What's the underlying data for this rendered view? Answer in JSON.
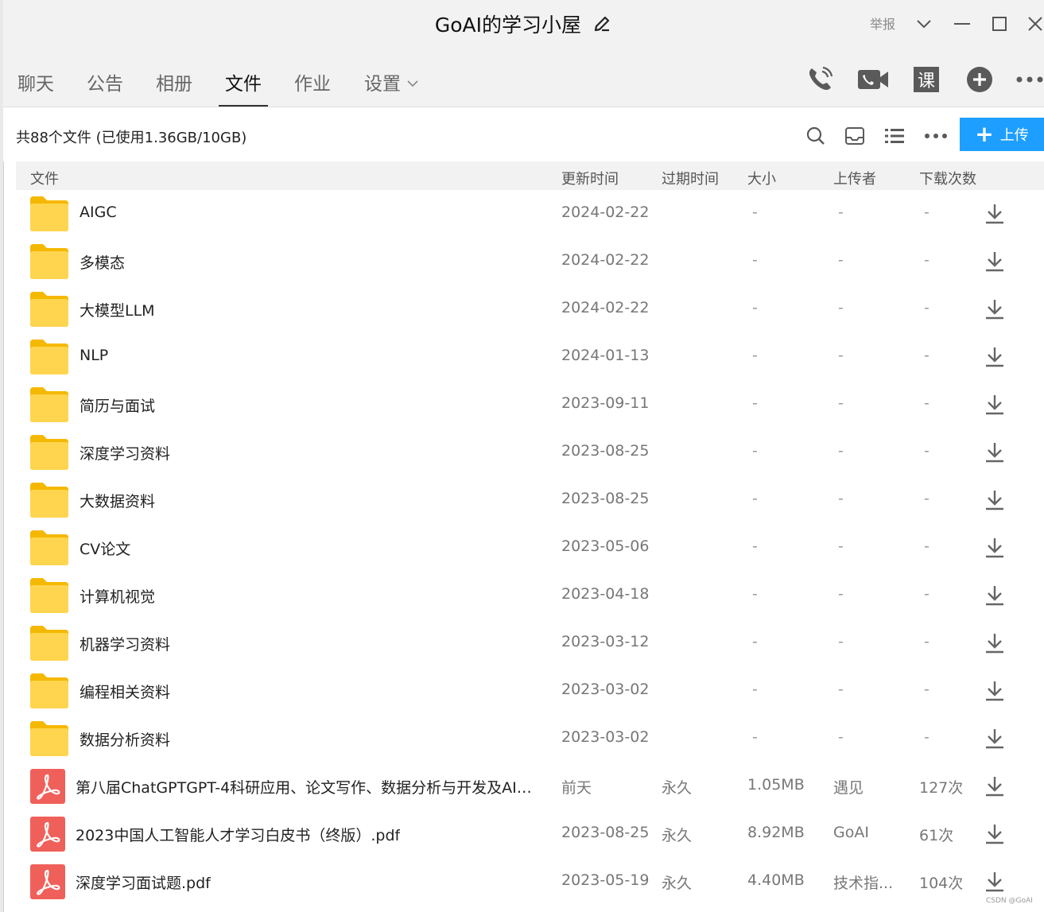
{
  "window": {
    "title": "GoAI的学习小屋",
    "report_label": "举报",
    "icons": [
      "edit-icon",
      "chevron-down-icon",
      "minimize-icon",
      "maximize-icon",
      "close-icon"
    ]
  },
  "tabs": [
    {
      "label": "聊天"
    },
    {
      "label": "公告"
    },
    {
      "label": "相册"
    },
    {
      "label": "文件",
      "active": true
    },
    {
      "label": "作业"
    },
    {
      "label": "设置"
    }
  ],
  "toolbar_icons": [
    "phone-icon",
    "video-icon",
    "course-icon",
    "add-circle-icon",
    "more-icon"
  ],
  "course_glyph": "课",
  "file_toolbar": {
    "summary": "共88个文件 (已使用1.36GB/10GB)",
    "upload_label": "上传",
    "icons": [
      "search-icon",
      "inbox-icon",
      "list-view-icon",
      "more-icon"
    ]
  },
  "columns": {
    "name": "文件",
    "updated": "更新时间",
    "expires": "过期时间",
    "size": "大小",
    "uploader": "上传者",
    "downloads": "下载次数"
  },
  "files": [
    {
      "type": "folder",
      "name": "AIGC",
      "updated": "2024-02-22",
      "expires": "",
      "size": "-",
      "uploader": "-",
      "downloads": "-"
    },
    {
      "type": "folder",
      "name": "多模态",
      "updated": "2024-02-22",
      "expires": "",
      "size": "-",
      "uploader": "-",
      "downloads": "-"
    },
    {
      "type": "folder",
      "name": "大模型LLM",
      "updated": "2024-02-22",
      "expires": "",
      "size": "-",
      "uploader": "-",
      "downloads": "-"
    },
    {
      "type": "folder",
      "name": "NLP",
      "updated": "2024-01-13",
      "expires": "",
      "size": "-",
      "uploader": "-",
      "downloads": "-"
    },
    {
      "type": "folder",
      "name": "简历与面试",
      "updated": "2023-09-11",
      "expires": "",
      "size": "-",
      "uploader": "-",
      "downloads": "-"
    },
    {
      "type": "folder",
      "name": "深度学习资料",
      "updated": "2023-08-25",
      "expires": "",
      "size": "-",
      "uploader": "-",
      "downloads": "-"
    },
    {
      "type": "folder",
      "name": "大数据资料",
      "updated": "2023-08-25",
      "expires": "",
      "size": "-",
      "uploader": "-",
      "downloads": "-"
    },
    {
      "type": "folder",
      "name": "CV论文",
      "updated": "2023-05-06",
      "expires": "",
      "size": "-",
      "uploader": "-",
      "downloads": "-"
    },
    {
      "type": "folder",
      "name": "计算机视觉",
      "updated": "2023-04-18",
      "expires": "",
      "size": "-",
      "uploader": "-",
      "downloads": "-"
    },
    {
      "type": "folder",
      "name": "机器学习资料",
      "updated": "2023-03-12",
      "expires": "",
      "size": "-",
      "uploader": "-",
      "downloads": "-"
    },
    {
      "type": "folder",
      "name": "编程相关资料",
      "updated": "2023-03-02",
      "expires": "",
      "size": "-",
      "uploader": "-",
      "downloads": "-"
    },
    {
      "type": "folder",
      "name": "数据分析资料",
      "updated": "2023-03-02",
      "expires": "",
      "size": "-",
      "uploader": "-",
      "downloads": "-"
    },
    {
      "type": "pdf",
      "name": "第八届ChatGPTGPT-4科研应用、论文写作、数据分析与开发及AI绘图...",
      "updated": "前天",
      "expires": "永久",
      "size": "1.05MB",
      "uploader": "遇见",
      "downloads": "127次"
    },
    {
      "type": "pdf",
      "name": "2023中国人工智能人才学习白皮书（终版）.pdf",
      "updated": "2023-08-25",
      "expires": "永久",
      "size": "8.92MB",
      "uploader": "GoAI",
      "downloads": "61次"
    },
    {
      "type": "pdf",
      "name": "深度学习面试题.pdf",
      "updated": "2023-05-19",
      "expires": "永久",
      "size": "4.40MB",
      "uploader": "技术指...",
      "downloads": "104次"
    }
  ],
  "colors": {
    "folder": "#ffd54f",
    "folder_tab": "#f5b800",
    "pdf": "#f0605a",
    "accent": "#1e9fff",
    "icon_gray": "#5a5a5a"
  },
  "watermark": "CSDN @GoAI"
}
